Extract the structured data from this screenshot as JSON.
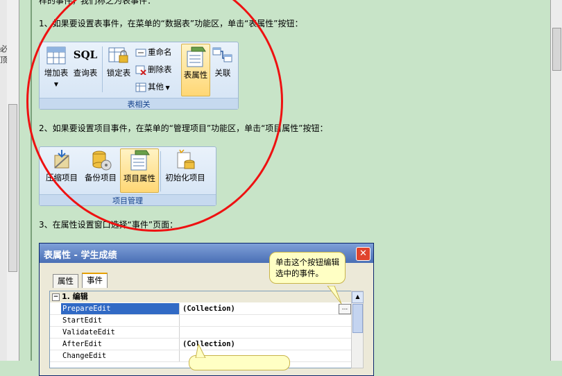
{
  "edge_chars": [
    "必",
    "顶"
  ],
  "top_partial_text": "样的事件，我们称之为表事件：",
  "steps": {
    "step1": "1、如果要设置表事件，在菜单的“数据表”功能区，单击“表属性”按钮：",
    "step2": "2、如果要设置项目事件，在菜单的“管理项目”功能区，单击“项目属性”按钮：",
    "step3": "3、在属性设置窗口选择“事件”页面："
  },
  "ribbon_table": {
    "group_label": "表相关",
    "add_table": "增加表",
    "query_table": "查询表",
    "lock_table": "锁定表",
    "rename": "重命名",
    "delete_table": "删除表",
    "other": "其他",
    "table_props": "表属性",
    "relation": "关联",
    "sql_text": "SQL"
  },
  "ribbon_project": {
    "group_label": "项目管理",
    "compress": "压缩项目",
    "backup": "备份项目",
    "project_props": "项目属性",
    "init": "初始化项目"
  },
  "dialog": {
    "title": "表属性 - 学生成绩",
    "close": "✕",
    "tab_props": "属性",
    "tab_events": "事件",
    "category": "1. 编辑",
    "rows": [
      {
        "name": "PrepareEdit",
        "value": "(Collection)"
      },
      {
        "name": "StartEdit",
        "value": ""
      },
      {
        "name": "ValidateEdit",
        "value": ""
      },
      {
        "name": "AfterEdit",
        "value": "(Collection)"
      },
      {
        "name": "ChangeEdit",
        "value": ""
      }
    ],
    "ellipsis": "...",
    "tooltip": "单击这个按钮编辑选中的事件。"
  },
  "colors": {
    "page_bg": "#c8e4c8",
    "circle": "#e11111",
    "highlight": "#ffd775"
  }
}
